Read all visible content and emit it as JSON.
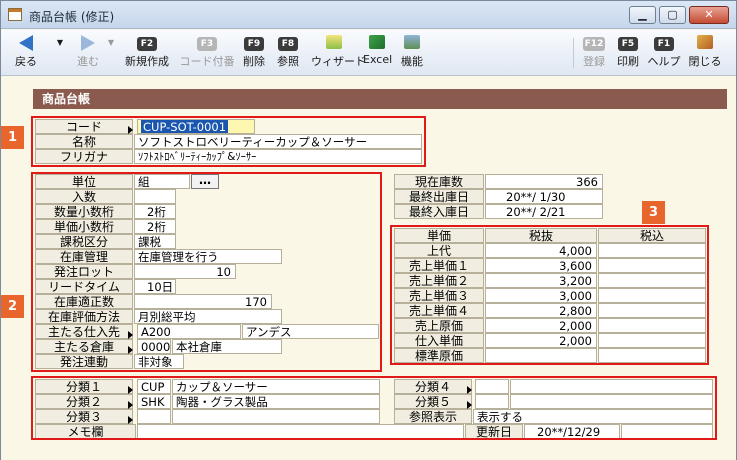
{
  "window": {
    "title": "商品台帳 (修正)"
  },
  "toolbar": {
    "back": "戻る",
    "forward": "進む",
    "new_key": "F2",
    "new": "新規作成",
    "code_key": "F3",
    "code": "コード付番",
    "delete_key": "F9",
    "delete": "削除",
    "ref_key": "F8",
    "ref": "参照",
    "wizard": "ウィザード",
    "excel": "Excel",
    "func": "機能",
    "register_key": "F12",
    "register": "登録",
    "print_key": "F5",
    "print": "印刷",
    "help_key": "F1",
    "help": "ヘルプ",
    "close": "閉じる"
  },
  "section_title": "商品台帳",
  "badges": [
    "1",
    "2",
    "3"
  ],
  "top": {
    "code_label": "コード",
    "code_value": "CUP-SOT-0001",
    "name_label": "名称",
    "name_value": "ソフトストロベリーティーカップ＆ソーサー",
    "kana_label": "フリガナ",
    "kana_value": "ｿﾌﾄｽﾄﾛﾍﾞﾘｰﾃｨｰｶｯﾌﾟ&ｿｰｻｰ"
  },
  "left": {
    "unit_label": "単位",
    "unit_value": "組",
    "unit_btn": "…",
    "irisu_label": "入数",
    "irisu_value": "",
    "qty_dec_label": "数量小数桁",
    "qty_dec_value": "2桁",
    "price_dec_label": "単価小数桁",
    "price_dec_value": "2桁",
    "tax_label": "課税区分",
    "tax_value": "課税",
    "stock_label": "在庫管理",
    "stock_value": "在庫管理を行う",
    "lot_label": "発注ロット",
    "lot_value": "10",
    "lead_label": "リードタイム",
    "lead_value": "10日",
    "proper_label": "在庫適正数",
    "proper_value": "170",
    "eval_label": "在庫評価方法",
    "eval_value": "月別総平均",
    "supplier_label": "主たる仕入先",
    "supplier_code": "A200",
    "supplier_name": "アンデス",
    "warehouse_label": "主たる倉庫",
    "warehouse_code": "0000",
    "warehouse_name": "本社倉庫",
    "order_label": "発注連動",
    "order_value": "非対象"
  },
  "stock": {
    "current_label": "現在庫数",
    "current_value": "366",
    "last_out_label": "最終出庫日",
    "last_out_value": "20**/ 1/30",
    "last_in_label": "最終入庫日",
    "last_in_value": "20**/ 2/21"
  },
  "price": {
    "col_price": "単価",
    "col_ex": "税抜",
    "col_in": "税込",
    "rows": [
      {
        "label": "上代",
        "ex": "4,000",
        "in": ""
      },
      {
        "label": "売上単価１",
        "ex": "3,600",
        "in": ""
      },
      {
        "label": "売上単価２",
        "ex": "3,200",
        "in": ""
      },
      {
        "label": "売上単価３",
        "ex": "3,000",
        "in": ""
      },
      {
        "label": "売上単価４",
        "ex": "2,800",
        "in": ""
      },
      {
        "label": "売上原価",
        "ex": "2,000",
        "in": ""
      },
      {
        "label": "仕入単価",
        "ex": "2,000",
        "in": ""
      },
      {
        "label": "標準原価",
        "ex": "",
        "in": ""
      }
    ]
  },
  "bottom": {
    "cat1_label": "分類１",
    "cat1_code": "CUP",
    "cat1_name": "カップ＆ソーサー",
    "cat2_label": "分類２",
    "cat2_code": "SHK",
    "cat2_name": "陶器・グラス製品",
    "cat3_label": "分類３",
    "cat3_code": "",
    "cat3_name": "",
    "cat4_label": "分類４",
    "cat4_code": "",
    "cat4_name": "",
    "cat5_label": "分類５",
    "cat5_code": "",
    "cat5_name": "",
    "ref_label": "参照表示",
    "ref_value": "表示する",
    "memo_label": "メモ欄",
    "memo_value": "",
    "updated_label": "更新日",
    "updated_value": "20**/12/29"
  }
}
